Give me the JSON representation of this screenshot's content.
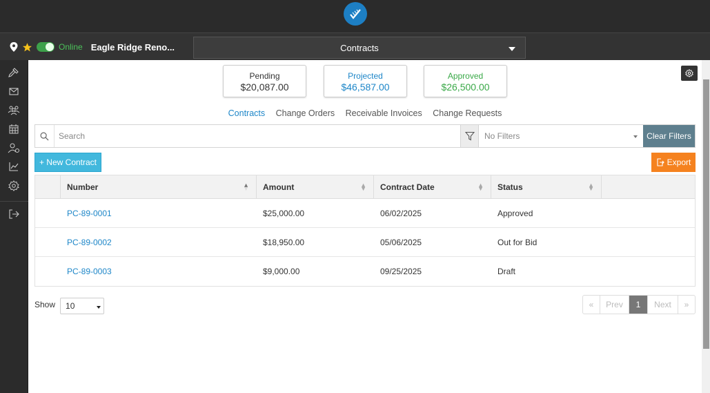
{
  "header": {
    "logo_icon": "brand-logo-icon"
  },
  "project": {
    "online_label": "Online",
    "name": "Eagle Ridge Reno...",
    "module": "Contracts"
  },
  "sidebar": {
    "items": [
      {
        "name": "hammer-icon"
      },
      {
        "name": "mail-icon"
      },
      {
        "name": "team-icon"
      },
      {
        "name": "calendar-icon"
      },
      {
        "name": "contacts-icon"
      },
      {
        "name": "chart-icon"
      },
      {
        "name": "settings-icon"
      },
      {
        "name": "logout-icon"
      }
    ]
  },
  "summary": {
    "pending": {
      "label": "Pending",
      "value": "$20,087.00"
    },
    "projected": {
      "label": "Projected",
      "value": "$46,587.00"
    },
    "approved": {
      "label": "Approved",
      "value": "$26,500.00"
    }
  },
  "tabs": [
    "Contracts",
    "Change Orders",
    "Receivable Invoices",
    "Change Requests"
  ],
  "search": {
    "placeholder": "Search",
    "filter_value": "No Filters",
    "clear_label": "Clear Filters"
  },
  "actions": {
    "new_label": "+ New Contract",
    "export_label": "Export"
  },
  "table": {
    "headers": [
      "Number",
      "Amount",
      "Contract Date",
      "Status"
    ],
    "rows": [
      {
        "number": "PC-89-0001",
        "amount": "$25,000.00",
        "date": "06/02/2025",
        "status": "Approved"
      },
      {
        "number": "PC-89-0002",
        "amount": "$18,950.00",
        "date": "05/06/2025",
        "status": "Out for Bid"
      },
      {
        "number": "PC-89-0003",
        "amount": "$9,000.00",
        "date": "09/25/2025",
        "status": "Draft"
      }
    ]
  },
  "pagination": {
    "show_label": "Show",
    "page_size": "10",
    "first": "«",
    "prev": "Prev",
    "current": "1",
    "next": "Next",
    "last": "»"
  },
  "colors": {
    "accent_blue": "#1d86c8",
    "approved_green": "#3aa948",
    "new_button": "#42b8dd",
    "export_button": "#f5821f",
    "clear_button": "#5e7f8e"
  }
}
